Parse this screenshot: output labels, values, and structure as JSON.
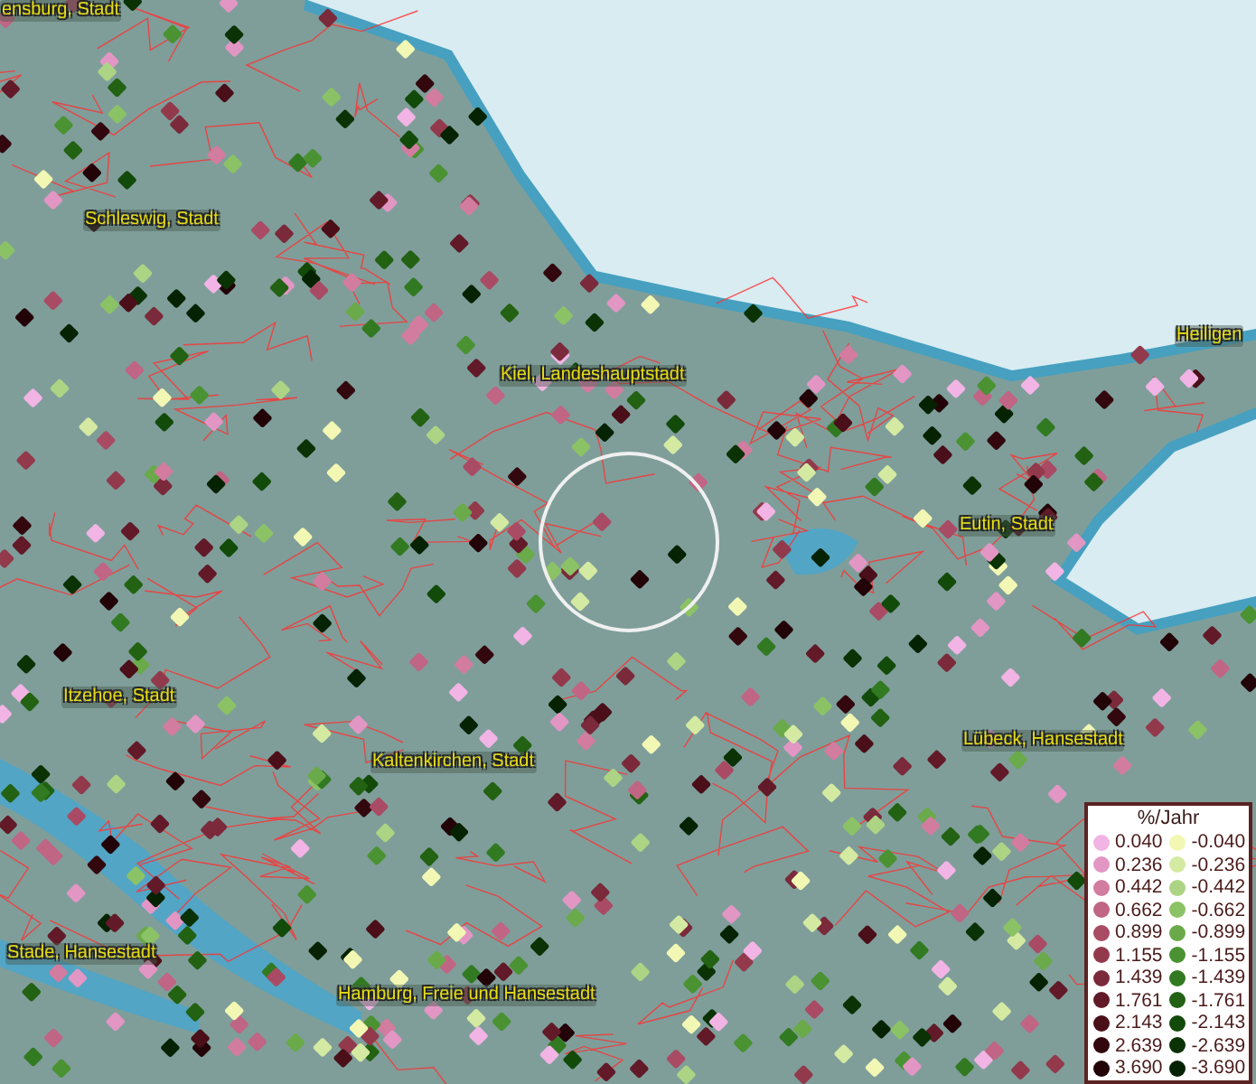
{
  "map": {
    "labels": [
      {
        "text": "ensburg, Stadt"
      },
      {
        "text": "Schleswig, Stadt"
      },
      {
        "text": "Kiel, Landeshauptstadt"
      },
      {
        "text": "Heiligen"
      },
      {
        "text": "Eutin, Stadt"
      },
      {
        "text": "Itzehoe, Stadt"
      },
      {
        "text": "Kaltenkirchen, Stadt"
      },
      {
        "text": "Lübeck, Hansestadt"
      },
      {
        "text": "Stade, Hansestadt"
      },
      {
        "text": "Hamburg, Freie und Hansestadt"
      }
    ]
  },
  "legend": {
    "title": "%/Jahr",
    "classes": [
      {
        "label": "0.040",
        "color": "#f2b4e4"
      },
      {
        "label": "0.236",
        "color": "#e296c4"
      },
      {
        "label": "0.442",
        "color": "#d27ca0"
      },
      {
        "label": "0.662",
        "color": "#c06584"
      },
      {
        "label": "0.899",
        "color": "#a94b64"
      },
      {
        "label": "1.155",
        "color": "#923a4c"
      },
      {
        "label": "1.439",
        "color": "#7a2a3a"
      },
      {
        "label": "1.761",
        "color": "#621a28"
      },
      {
        "label": "2.143",
        "color": "#4a0f18"
      },
      {
        "label": "2.639",
        "color": "#32080e"
      },
      {
        "label": "3.690",
        "color": "#220408"
      },
      {
        "label": "-0.040",
        "color": "#f2f8b4"
      },
      {
        "label": "-0.236",
        "color": "#d4eaa2"
      },
      {
        "label": "-0.442",
        "color": "#acd484"
      },
      {
        "label": "-0.662",
        "color": "#8cc266"
      },
      {
        "label": "-0.899",
        "color": "#6aaa4a"
      },
      {
        "label": "-1.155",
        "color": "#4a9232"
      },
      {
        "label": "-1.439",
        "color": "#327a22"
      },
      {
        "label": "-1.761",
        "color": "#226212"
      },
      {
        "label": "-2.143",
        "color": "#124a0a"
      },
      {
        "label": "-2.639",
        "color": "#0a3204"
      },
      {
        "label": "-3.690",
        "color": "#052202"
      }
    ]
  }
}
